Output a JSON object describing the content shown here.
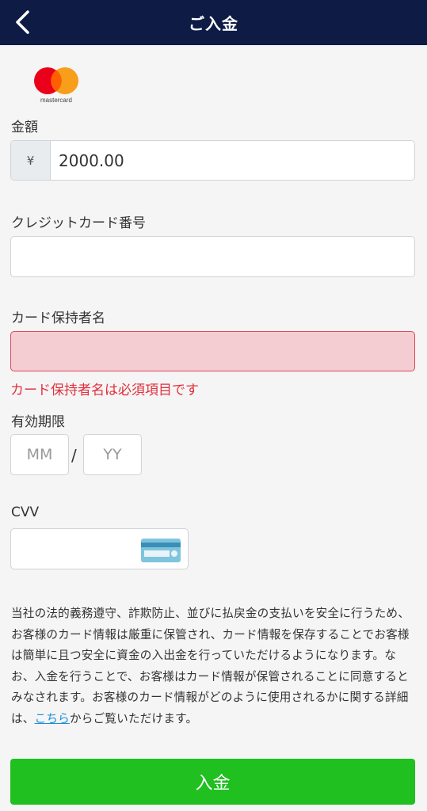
{
  "header": {
    "title": "ご入金",
    "back_icon": "chevron-left-icon"
  },
  "logo": {
    "brand": "mastercard",
    "icon": "mastercard-logo",
    "colors": [
      "#eb001b",
      "#f79e1b"
    ]
  },
  "amount": {
    "label": "金額",
    "currency_symbol": "¥",
    "value": "2000.00"
  },
  "card_number": {
    "label": "クレジットカード番号",
    "value": ""
  },
  "holder": {
    "label": "カード保持者名",
    "value": "",
    "error": "カード保持者名は必須項目です"
  },
  "expiry": {
    "label": "有効期限",
    "month_placeholder": "MM",
    "separator": "/",
    "year_placeholder": "YY"
  },
  "cvv": {
    "label": "CVV",
    "value": "",
    "icon": "card-back-icon"
  },
  "notice": {
    "text": "当社の法的義務遵守、詐欺防止、並びに払戻金の支払いを安全に行うため、お客様のカード情報は厳重に保管され、カード情報を保存することでお客様は簡単に且つ安全に資金の入出金を行っていただけるようになります。なお、入金を行うことで、お客様はカード情報が保管されることに同意するとみなされます。お客様のカード情報がどのように使用されるかに関する詳細は、",
    "link": "こちら",
    "suffix": "からご覧いただけます。"
  },
  "submit": {
    "label": "入金"
  },
  "colors": {
    "header_bg": "#0d1b45",
    "submit_bg": "#1fc01f",
    "error": "#e0303e",
    "error_bg": "#f4cdd3",
    "link": "#1a8fd8"
  }
}
